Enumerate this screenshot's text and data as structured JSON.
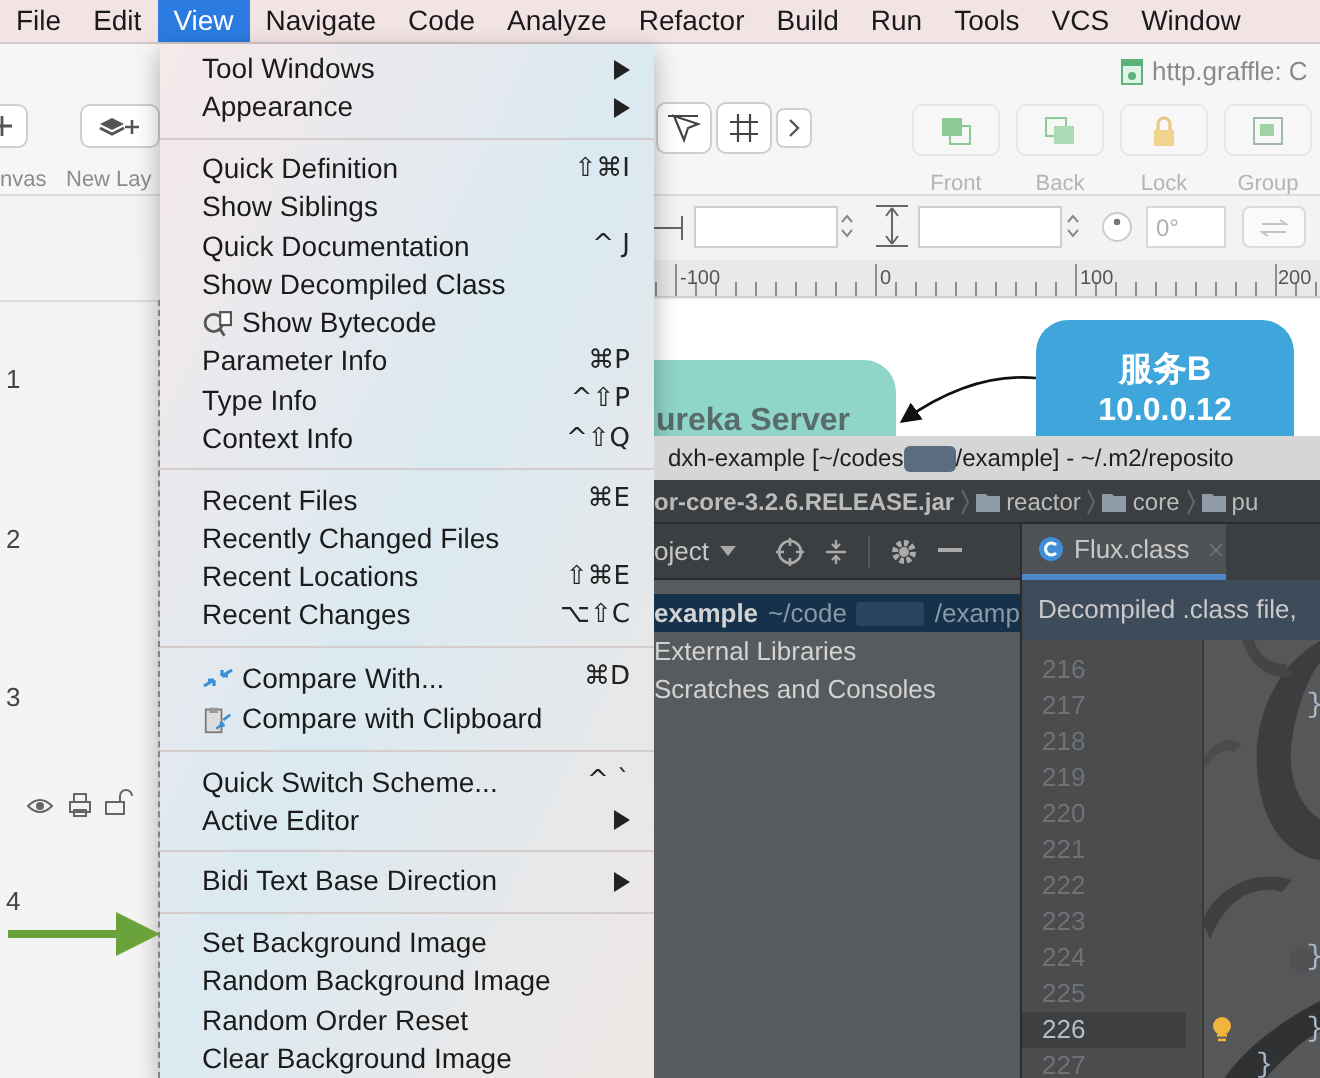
{
  "menu_bar": [
    {
      "label": "File",
      "selected": false
    },
    {
      "label": "Edit",
      "selected": false
    },
    {
      "label": "View",
      "selected": true
    },
    {
      "label": "Navigate",
      "selected": false
    },
    {
      "label": "Code",
      "selected": false
    },
    {
      "label": "Analyze",
      "selected": false
    },
    {
      "label": "Refactor",
      "selected": false
    },
    {
      "label": "Build",
      "selected": false
    },
    {
      "label": "Run",
      "selected": false
    },
    {
      "label": "Tools",
      "selected": false
    },
    {
      "label": "VCS",
      "selected": false
    },
    {
      "label": "Window",
      "selected": false
    }
  ],
  "view_menu": {
    "groups": [
      [
        {
          "label": "Tool Windows",
          "kind": "submenu"
        },
        {
          "label": "Appearance",
          "kind": "submenu"
        }
      ],
      [
        {
          "label": "Quick Definition",
          "kind": "command",
          "shortcut": "⇧⌘I"
        },
        {
          "label": "Show Siblings",
          "kind": "command"
        },
        {
          "label": "Quick Documentation",
          "kind": "command",
          "shortcut": "^ J"
        },
        {
          "label": "Show Decompiled Class",
          "kind": "command"
        },
        {
          "label": "Show Bytecode",
          "kind": "command"
        },
        {
          "label": "Parameter Info",
          "kind": "command",
          "shortcut": "⌘P"
        },
        {
          "label": "Type Info",
          "kind": "command",
          "shortcut": "^⇧P"
        },
        {
          "label": "Context Info",
          "kind": "command",
          "shortcut": "^⇧Q"
        }
      ],
      [
        {
          "label": "Recent Files",
          "kind": "command",
          "shortcut": "⌘E"
        },
        {
          "label": "Recently Changed Files",
          "kind": "command"
        },
        {
          "label": "Recent Locations",
          "kind": "command",
          "shortcut": "⇧⌘E"
        },
        {
          "label": "Recent Changes",
          "kind": "command",
          "shortcut": "⌥⇧C"
        }
      ],
      [
        {
          "label": "Compare With...",
          "kind": "command",
          "shortcut": "⌘D"
        },
        {
          "label": "Compare with Clipboard",
          "kind": "command"
        }
      ],
      [
        {
          "label": "Quick Switch Scheme...",
          "kind": "command",
          "shortcut": "^ `"
        },
        {
          "label": "Active Editor",
          "kind": "submenu"
        }
      ],
      [
        {
          "label": "Bidi Text Base Direction",
          "kind": "submenu"
        }
      ],
      [
        {
          "label": "Set Background Image",
          "kind": "command"
        },
        {
          "label": "Random Background Image",
          "kind": "command"
        },
        {
          "label": "Random Order Reset",
          "kind": "command"
        },
        {
          "label": "Clear Background Image",
          "kind": "command"
        }
      ]
    ]
  },
  "graffle": {
    "document_title": "http.graffle: C",
    "toolbar_left": [
      {
        "label": "nvas"
      },
      {
        "label": "New Lay"
      }
    ],
    "toolbar_right": [
      {
        "label": "Front",
        "disabled": true
      },
      {
        "label": "Back",
        "disabled": true
      },
      {
        "label": "Lock",
        "disabled": true
      },
      {
        "label": "Group",
        "disabled": true
      }
    ],
    "rotation": {
      "placeholder": "0°"
    },
    "ruler_labels": [
      "-100",
      "0",
      "100",
      "200"
    ],
    "layer_numbers": [
      "1",
      "2",
      "3",
      "4"
    ],
    "nodes": [
      {
        "lines": [
          "ureka Server"
        ],
        "color": "#8fd6c8"
      },
      {
        "lines": [
          "服务B",
          "10.0.0.12"
        ],
        "color": "#3fa6dc"
      }
    ]
  },
  "ide": {
    "title_parts": [
      "dxh-example [~/codes",
      "/example] - ~/.m2/reposito"
    ],
    "breadcrumbs": [
      {
        "label": "or-core-3.2.6.RELEASE.jar",
        "kind": "jar"
      },
      {
        "label": "reactor",
        "kind": "folder"
      },
      {
        "label": "core",
        "kind": "folder"
      },
      {
        "label": "pu",
        "kind": "folder"
      }
    ],
    "project_header": "oject",
    "tabs": [
      {
        "label": "Flux.class",
        "selected": true
      }
    ],
    "tree": [
      {
        "label": "example",
        "location_parts": [
          "~/code",
          "/examp"
        ],
        "selected": true
      },
      {
        "label": "External Libraries",
        "selected": false
      },
      {
        "label": "Scratches and Consoles",
        "selected": false
      }
    ],
    "banner": "Decompiled .class file,",
    "lines": [
      {
        "number": "216",
        "current": false
      },
      {
        "number": "217",
        "text": "   }",
        "current": false
      },
      {
        "number": "218",
        "current": false
      },
      {
        "number": "219",
        "current": false
      },
      {
        "number": "220",
        "current": false
      },
      {
        "number": "221",
        "current": false
      },
      {
        "number": "222",
        "current": false
      },
      {
        "number": "223",
        "current": false
      },
      {
        "number": "224",
        "text": "   }",
        "current": false
      },
      {
        "number": "225",
        "current": false
      },
      {
        "number": "226",
        "text": "   }",
        "current": true
      },
      {
        "number": "227",
        "text": "}",
        "current": false
      }
    ]
  }
}
